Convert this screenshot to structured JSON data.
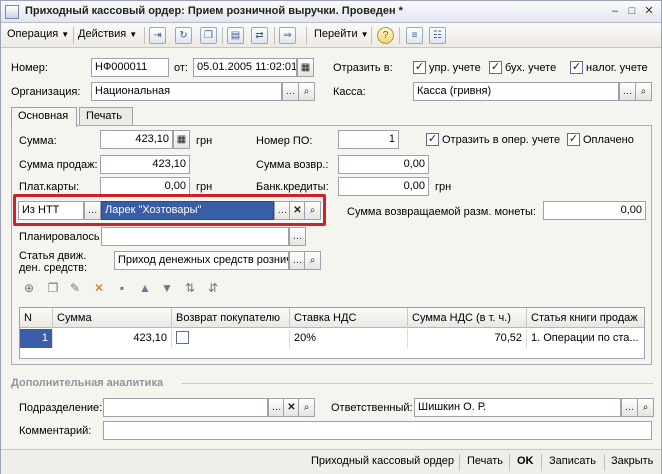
{
  "window": {
    "title": "Приходный кассовый ордер: Прием розничной выручки. Проведен *",
    "minimize": "–",
    "maximize": "□",
    "close": "✕"
  },
  "toolbar": {
    "operation": "Операция",
    "actions": "Действия",
    "goto": "Перейти",
    "help": "?"
  },
  "header": {
    "number_label": "Номер:",
    "number_value": "НФ000011",
    "date_label": "от:",
    "date_value": "05.01.2005 11:02:01",
    "reflect_label": "Отразить в:",
    "reflect_mgmt": "упр. учете",
    "reflect_acc": "бух. учете",
    "reflect_tax": "налог. учете",
    "org_label": "Организация:",
    "org_value": "Национальная",
    "cash_label": "Касса:",
    "cash_value": "Касса (гривня)"
  },
  "tabs": [
    "Основная",
    "Печать"
  ],
  "main": {
    "sum_label": "Сумма:",
    "sum_value": "423,10",
    "currency": "грн",
    "po_label": "Номер ПО:",
    "po_value": "1",
    "reflect_oper_label": "Отразить в опер. учете",
    "paid_label": "Оплачено",
    "sales_sum_label": "Сумма продаж:",
    "sales_sum_value": "423,10",
    "return_sum_label": "Сумма возвр.:",
    "return_sum_value": "0,00",
    "cards_label": "Плат.карты:",
    "cards_value": "0,00",
    "cards_currency": "грн",
    "bank_label": "Банк.кредиты:",
    "bank_value": "0,00",
    "bank_currency": "грн",
    "source_value": "Из НТТ",
    "store_value": "Ларек \"Хозтовары\"",
    "coins_label": "Сумма возвращаемой разм. монеты:",
    "coins_value": "0,00",
    "planned_label": "Планировалось",
    "cashflow_label": "Статья движ. ден. средств:",
    "cashflow_value": "Приход денежных средств рознична"
  },
  "table": {
    "columns": [
      "N",
      "Сумма",
      "Возврат покупателю",
      "Ставка НДС",
      "Сумма НДС (в т. ч.)",
      "Статья книги продаж"
    ],
    "rows": [
      {
        "n": "1",
        "sum": "423,10",
        "return": "",
        "vat_rate": "20%",
        "vat_sum": "70,52",
        "sales_book": "1. Операции по ста..."
      }
    ]
  },
  "extra": {
    "section_title": "Дополнительная аналитика",
    "dept_label": "Подразделение:",
    "dept_value": "",
    "resp_label": "Ответственный:",
    "resp_value": "Шишкин О. Р.",
    "comment_label": "Комментарий:",
    "comment_value": ""
  },
  "footer": {
    "doc_name": "Приходный кассовый ордер",
    "print": "Печать",
    "ok": "OK",
    "save": "Записать",
    "close": "Закрыть"
  },
  "colors": {
    "highlight": "#d0202a",
    "selected_field": "#3a5da8"
  }
}
